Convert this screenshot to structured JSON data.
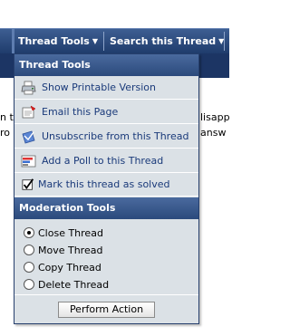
{
  "nav": {
    "thread_tools": "Thread Tools",
    "search_thread": "Search this Thread"
  },
  "background": {
    "left_line_1": "n t",
    "left_line_2": "ro",
    "right_line_1": "lisapp",
    "right_line_2": "answ"
  },
  "thread_tools": {
    "title": "Thread Tools",
    "items": [
      {
        "label": "Show Printable Version",
        "icon": "printer-icon"
      },
      {
        "label": "Email this Page",
        "icon": "email-icon"
      },
      {
        "label": "Unsubscribe from this Thread",
        "icon": "unsubscribe-icon"
      },
      {
        "label": "Add a Poll to this Thread",
        "icon": "poll-icon"
      },
      {
        "label": "Mark this thread as solved",
        "icon": "checkbox-icon"
      }
    ]
  },
  "moderation": {
    "title": "Moderation Tools",
    "options": [
      {
        "label": "Close Thread",
        "checked": true
      },
      {
        "label": "Move Thread",
        "checked": false
      },
      {
        "label": "Copy Thread",
        "checked": false
      },
      {
        "label": "Delete Thread",
        "checked": false
      }
    ],
    "perform_label": "Perform Action"
  },
  "colors": {
    "header": "#2b4a7c",
    "menu_bg": "#dbe1e6",
    "link": "#1a3a7a"
  }
}
